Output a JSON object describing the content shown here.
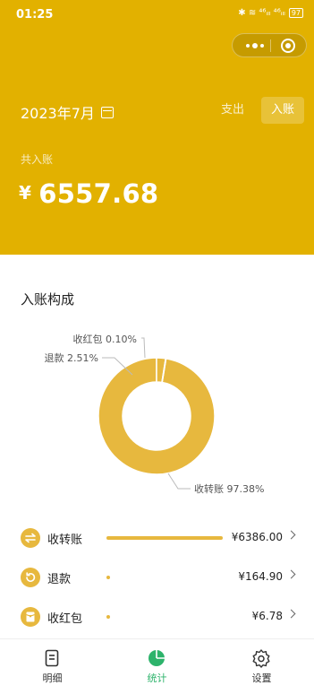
{
  "status_bar": {
    "time": "01:25",
    "icons": "✱ ≋ ⁴⁶ᵢₗₗ ⁴⁶ᵢₗₗ",
    "battery": "97"
  },
  "header": {
    "month": "2023年7月",
    "tabs": {
      "expense": "支出",
      "income": "入账"
    },
    "total_label": "共入账",
    "currency": "¥",
    "total_amount": "6557.68"
  },
  "composition": {
    "title": "入账构成",
    "labels": {
      "red_packet": "收红包 0.10%",
      "refund": "退款 2.51%",
      "transfer": "收转账 97.38%"
    }
  },
  "chart_data": {
    "type": "pie",
    "donut": true,
    "categories": [
      "收转账",
      "退款",
      "收红包"
    ],
    "values": [
      97.38,
      2.51,
      0.1
    ],
    "unit": "%",
    "color": "#E7B83E"
  },
  "rows": [
    {
      "label": "收转账",
      "amount": "¥6386.00",
      "share": 0.9738,
      "icon": "transfer-icon"
    },
    {
      "label": "退款",
      "amount": "¥164.90",
      "share": 0.0251,
      "icon": "refund-icon"
    },
    {
      "label": "收红包",
      "amount": "¥6.78",
      "share": 0.001,
      "icon": "red-packet-icon"
    }
  ],
  "nav": {
    "items": [
      {
        "label": "明细",
        "icon": "document-icon",
        "active": false
      },
      {
        "label": "统计",
        "icon": "pie-chart-icon",
        "active": true
      },
      {
        "label": "设置",
        "icon": "gear-icon",
        "active": false
      }
    ]
  },
  "colors": {
    "header": "#E2B100",
    "accent": "#E7B83E",
    "active_tab": "#2DB36B"
  }
}
